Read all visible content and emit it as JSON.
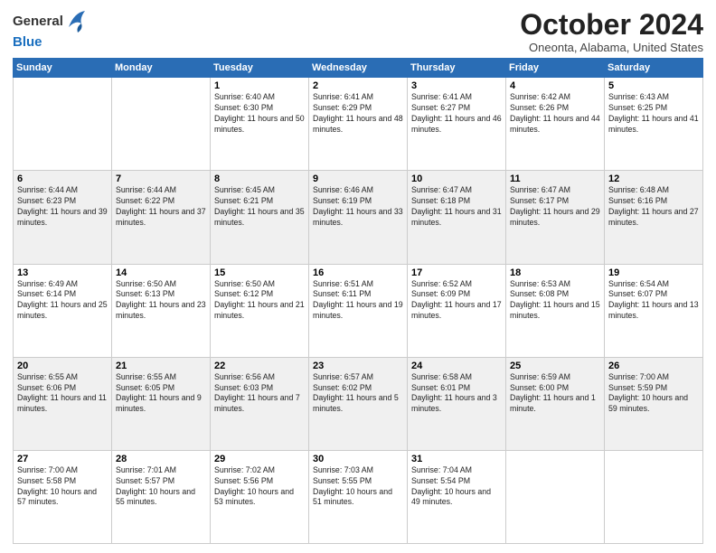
{
  "header": {
    "logo_line1": "General",
    "logo_line2": "Blue",
    "month": "October 2024",
    "location": "Oneonta, Alabama, United States"
  },
  "weekdays": [
    "Sunday",
    "Monday",
    "Tuesday",
    "Wednesday",
    "Thursday",
    "Friday",
    "Saturday"
  ],
  "weeks": [
    [
      {
        "day": "",
        "info": ""
      },
      {
        "day": "",
        "info": ""
      },
      {
        "day": "1",
        "info": "Sunrise: 6:40 AM\nSunset: 6:30 PM\nDaylight: 11 hours and 50 minutes."
      },
      {
        "day": "2",
        "info": "Sunrise: 6:41 AM\nSunset: 6:29 PM\nDaylight: 11 hours and 48 minutes."
      },
      {
        "day": "3",
        "info": "Sunrise: 6:41 AM\nSunset: 6:27 PM\nDaylight: 11 hours and 46 minutes."
      },
      {
        "day": "4",
        "info": "Sunrise: 6:42 AM\nSunset: 6:26 PM\nDaylight: 11 hours and 44 minutes."
      },
      {
        "day": "5",
        "info": "Sunrise: 6:43 AM\nSunset: 6:25 PM\nDaylight: 11 hours and 41 minutes."
      }
    ],
    [
      {
        "day": "6",
        "info": "Sunrise: 6:44 AM\nSunset: 6:23 PM\nDaylight: 11 hours and 39 minutes."
      },
      {
        "day": "7",
        "info": "Sunrise: 6:44 AM\nSunset: 6:22 PM\nDaylight: 11 hours and 37 minutes."
      },
      {
        "day": "8",
        "info": "Sunrise: 6:45 AM\nSunset: 6:21 PM\nDaylight: 11 hours and 35 minutes."
      },
      {
        "day": "9",
        "info": "Sunrise: 6:46 AM\nSunset: 6:19 PM\nDaylight: 11 hours and 33 minutes."
      },
      {
        "day": "10",
        "info": "Sunrise: 6:47 AM\nSunset: 6:18 PM\nDaylight: 11 hours and 31 minutes."
      },
      {
        "day": "11",
        "info": "Sunrise: 6:47 AM\nSunset: 6:17 PM\nDaylight: 11 hours and 29 minutes."
      },
      {
        "day": "12",
        "info": "Sunrise: 6:48 AM\nSunset: 6:16 PM\nDaylight: 11 hours and 27 minutes."
      }
    ],
    [
      {
        "day": "13",
        "info": "Sunrise: 6:49 AM\nSunset: 6:14 PM\nDaylight: 11 hours and 25 minutes."
      },
      {
        "day": "14",
        "info": "Sunrise: 6:50 AM\nSunset: 6:13 PM\nDaylight: 11 hours and 23 minutes."
      },
      {
        "day": "15",
        "info": "Sunrise: 6:50 AM\nSunset: 6:12 PM\nDaylight: 11 hours and 21 minutes."
      },
      {
        "day": "16",
        "info": "Sunrise: 6:51 AM\nSunset: 6:11 PM\nDaylight: 11 hours and 19 minutes."
      },
      {
        "day": "17",
        "info": "Sunrise: 6:52 AM\nSunset: 6:09 PM\nDaylight: 11 hours and 17 minutes."
      },
      {
        "day": "18",
        "info": "Sunrise: 6:53 AM\nSunset: 6:08 PM\nDaylight: 11 hours and 15 minutes."
      },
      {
        "day": "19",
        "info": "Sunrise: 6:54 AM\nSunset: 6:07 PM\nDaylight: 11 hours and 13 minutes."
      }
    ],
    [
      {
        "day": "20",
        "info": "Sunrise: 6:55 AM\nSunset: 6:06 PM\nDaylight: 11 hours and 11 minutes."
      },
      {
        "day": "21",
        "info": "Sunrise: 6:55 AM\nSunset: 6:05 PM\nDaylight: 11 hours and 9 minutes."
      },
      {
        "day": "22",
        "info": "Sunrise: 6:56 AM\nSunset: 6:03 PM\nDaylight: 11 hours and 7 minutes."
      },
      {
        "day": "23",
        "info": "Sunrise: 6:57 AM\nSunset: 6:02 PM\nDaylight: 11 hours and 5 minutes."
      },
      {
        "day": "24",
        "info": "Sunrise: 6:58 AM\nSunset: 6:01 PM\nDaylight: 11 hours and 3 minutes."
      },
      {
        "day": "25",
        "info": "Sunrise: 6:59 AM\nSunset: 6:00 PM\nDaylight: 11 hours and 1 minute."
      },
      {
        "day": "26",
        "info": "Sunrise: 7:00 AM\nSunset: 5:59 PM\nDaylight: 10 hours and 59 minutes."
      }
    ],
    [
      {
        "day": "27",
        "info": "Sunrise: 7:00 AM\nSunset: 5:58 PM\nDaylight: 10 hours and 57 minutes."
      },
      {
        "day": "28",
        "info": "Sunrise: 7:01 AM\nSunset: 5:57 PM\nDaylight: 10 hours and 55 minutes."
      },
      {
        "day": "29",
        "info": "Sunrise: 7:02 AM\nSunset: 5:56 PM\nDaylight: 10 hours and 53 minutes."
      },
      {
        "day": "30",
        "info": "Sunrise: 7:03 AM\nSunset: 5:55 PM\nDaylight: 10 hours and 51 minutes."
      },
      {
        "day": "31",
        "info": "Sunrise: 7:04 AM\nSunset: 5:54 PM\nDaylight: 10 hours and 49 minutes."
      },
      {
        "day": "",
        "info": ""
      },
      {
        "day": "",
        "info": ""
      }
    ]
  ]
}
